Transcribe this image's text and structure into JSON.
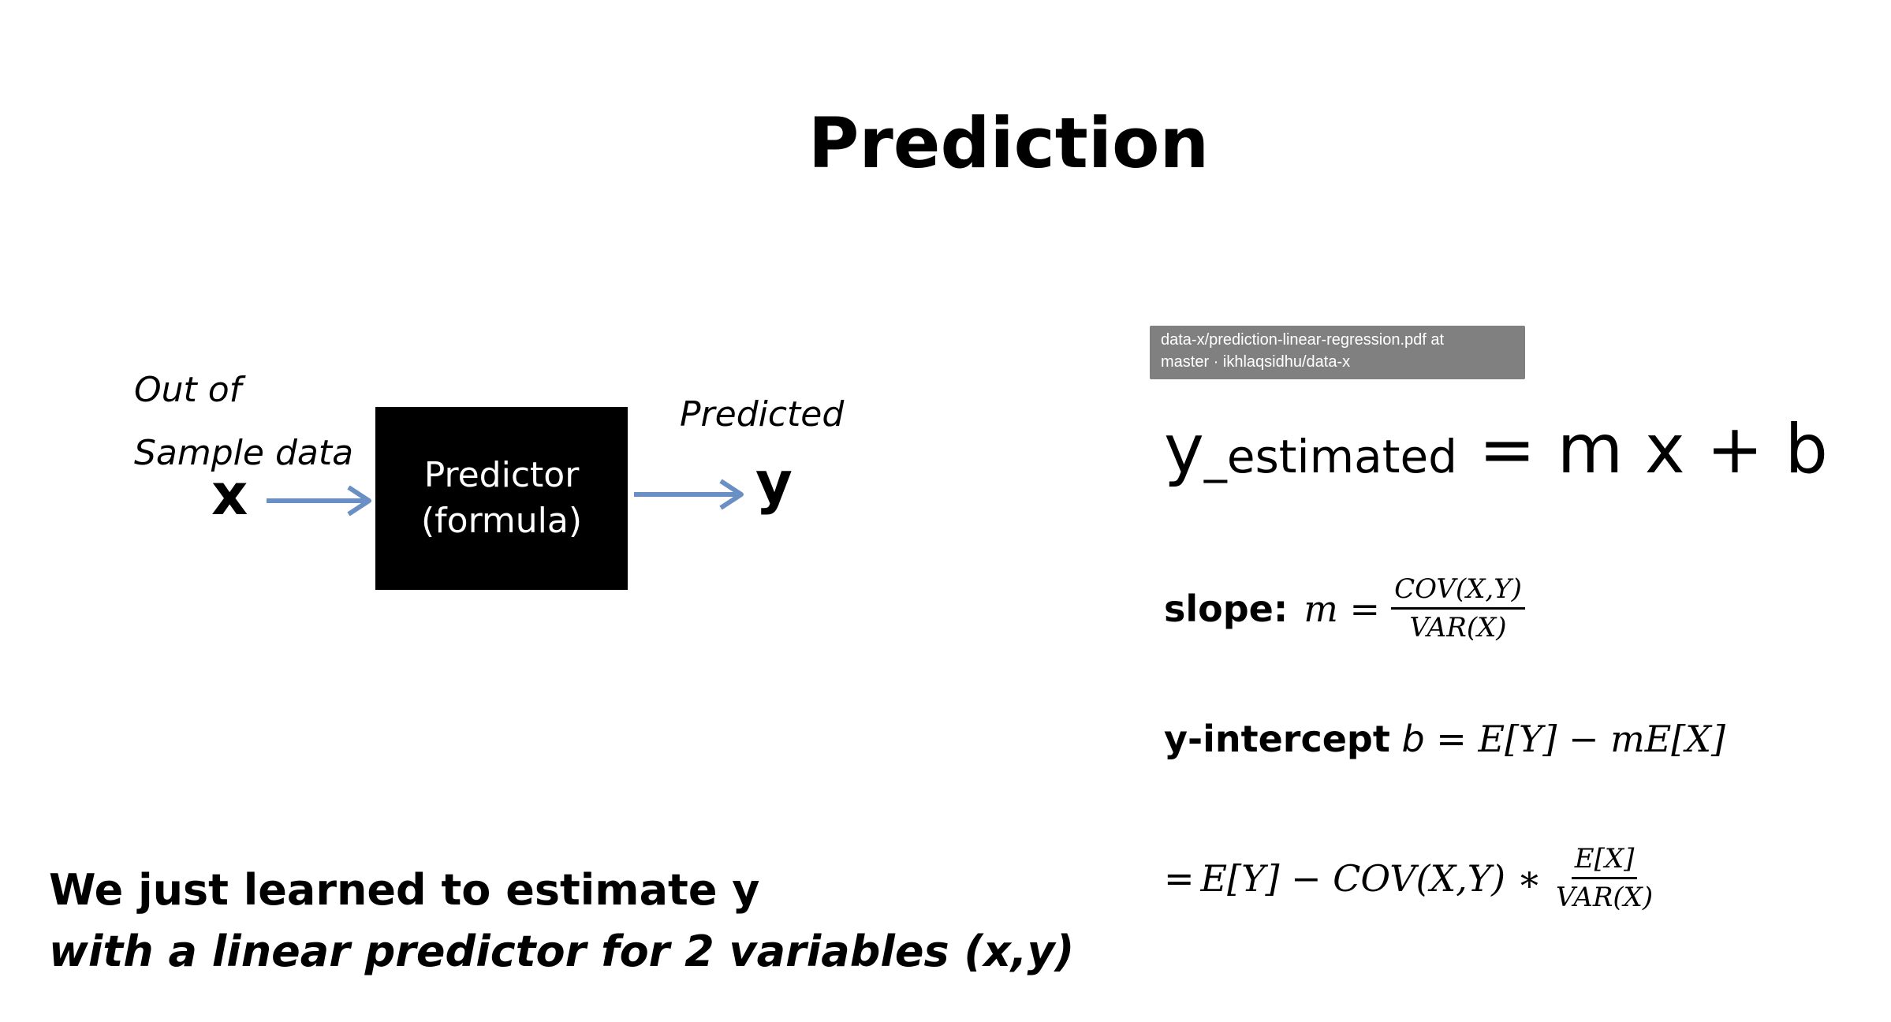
{
  "title": "Prediction",
  "diagram": {
    "input_label_line1": "Out of",
    "input_label_line2": "Sample data",
    "input_var": "x",
    "box_line1": "Predictor",
    "box_line2": "(formula)",
    "output_label": "Predicted",
    "output_var": "y",
    "arrow_color": "#6a8fc4"
  },
  "tooltip": {
    "line1": "data-x/prediction-linear-regression.pdf at",
    "line2": "master · ikhlaqsidhu/data-x"
  },
  "equations": {
    "main_y": "y",
    "main_sub": "_estimated",
    "main_rhs": " = m x + b",
    "slope_label": "slope:",
    "slope_lhs": "m =",
    "slope_num": "COV(X,Y)",
    "slope_den": "VAR(X)",
    "intercept_label": "y-intercept",
    "intercept_b": "b",
    "intercept_eq": " = ",
    "intercept_rhs": "E[Y] − mE[X]",
    "expanded_prefix": "= ",
    "expanded_rhs": "E[Y] − COV(X,Y) ∗",
    "expanded_num": "E[X]",
    "expanded_den": "VAR(X)"
  },
  "footer": {
    "line1": "We just learned to estimate y",
    "line2": "with a linear predictor for 2 variables (x,y)"
  }
}
